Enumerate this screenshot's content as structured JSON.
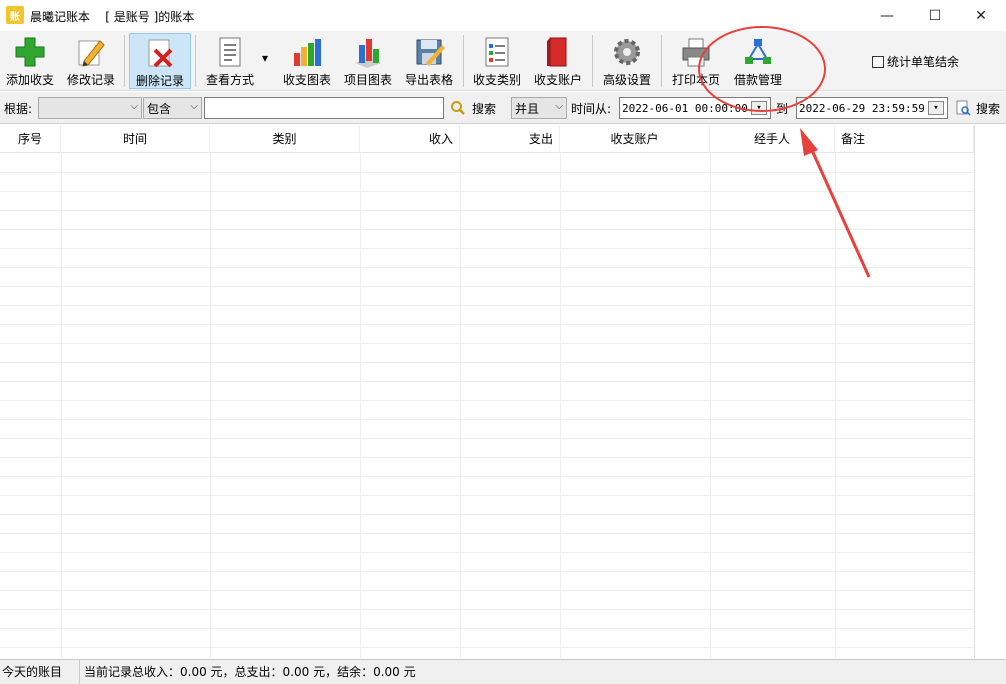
{
  "window": {
    "app_icon_text": "账",
    "title": "晨曦记账本    [ 是账号 ]的账本",
    "minimize": "—",
    "maximize": "☐",
    "close": "✕"
  },
  "toolbar": {
    "add": "添加收支",
    "edit": "修改记录",
    "delete": "删除记录",
    "view_mode": "查看方式",
    "income_chart": "收支图表",
    "item_chart": "项目图表",
    "export": "导出表格",
    "categories": "收支类别",
    "accounts": "收支账户",
    "advanced": "高级设置",
    "print": "打印本页",
    "loan": "借款管理",
    "dropdown_arrow": "▾",
    "single_balance": "统计单笔结余"
  },
  "filter": {
    "by_label": "根据:",
    "by_value": "",
    "mode_value": "包含",
    "search_text": "",
    "search_label": "搜索",
    "logic_value": "并且",
    "time_from_label": "时间从:",
    "date_from": "2022-06-01 00:00:00",
    "to_label": "到",
    "date_to": "2022-06-29 23:59:59",
    "search2_label": "搜索"
  },
  "table": {
    "columns": [
      "序号",
      "时间",
      "类别",
      "收入",
      "支出",
      "收支账户",
      "经手人",
      "备注"
    ],
    "rows": []
  },
  "status": {
    "today": "今天的账目",
    "summary": "当前记录总收入：0.00 元，总支出：0.00 元，结余：0.00 元"
  },
  "colors": {
    "annotation_red": "#e8403a",
    "toolbar_bg": "#f3f3f3",
    "active_btn_bg": "#cde6f7"
  }
}
